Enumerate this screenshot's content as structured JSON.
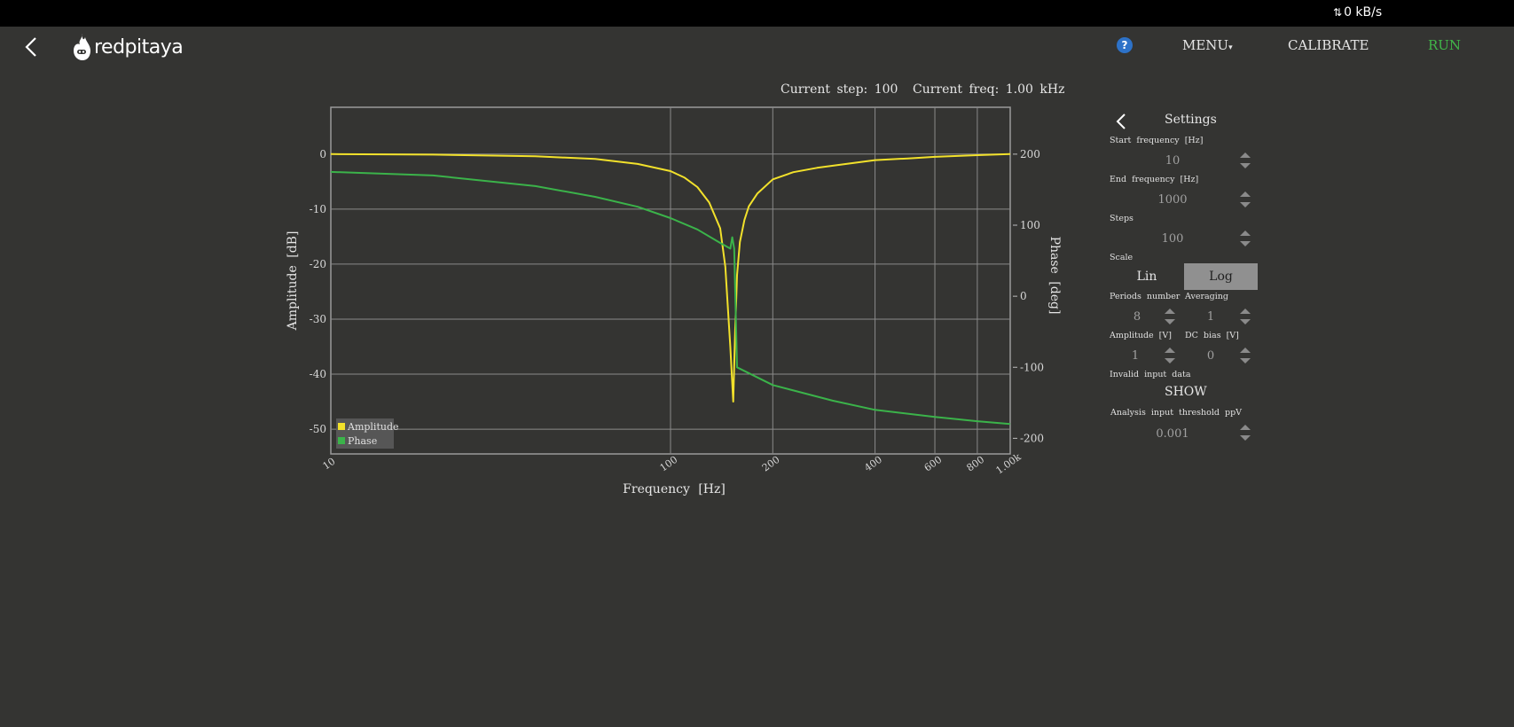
{
  "header": {
    "data_rate": "0 kB/s",
    "logo_text": "redpitaya",
    "help_label": "?",
    "menu_label": "MENU",
    "calibrate_label": "CALIBRATE",
    "run_label": "RUN"
  },
  "status": {
    "current_step": "Current step: 100",
    "current_freq": "Current freq: 1.00 kHz"
  },
  "settings": {
    "title": "Settings",
    "start_frequency_label": "Start frequency [Hz]",
    "start_frequency": "10",
    "end_frequency_label": "End frequency [Hz]",
    "end_frequency": "1000",
    "steps_label": "Steps",
    "steps": "100",
    "scale_label": "Scale",
    "scale_lin": "Lin",
    "scale_log": "Log",
    "scale_selected": "Log",
    "periods_label": "Periods number",
    "periods": "8",
    "averaging_label": "Averaging",
    "averaging": "1",
    "amplitude_label": "Amplitude [V]",
    "amplitude": "1",
    "dc_bias_label": "DC bias [V]",
    "dc_bias": "0",
    "invalid_input_label": "Invalid input data",
    "show_label": "SHOW",
    "threshold_label": "Analysis input threshold ppV",
    "threshold": "0.001"
  },
  "colors": {
    "amplitude": "#f2e12b",
    "phase": "#3bb34a",
    "run": "#41b649",
    "background": "#343432"
  },
  "chart_data": {
    "type": "line",
    "xlabel": "Frequency [Hz]",
    "ylabel": "Amplitude [dB]",
    "y2label": "Phase [deg]",
    "x_scale": "log",
    "xlim": [
      10,
      1000
    ],
    "ylim": [
      -54.5,
      8.5
    ],
    "y2lim": [
      -222,
      266
    ],
    "x_ticks": [
      "10",
      "100",
      "200",
      "400",
      "600",
      "800",
      "1.00k"
    ],
    "x_tick_values": [
      10,
      100,
      200,
      400,
      600,
      800,
      1000
    ],
    "y_ticks": [
      0,
      -10,
      -20,
      -30,
      -40,
      -50
    ],
    "y2_ticks": [
      200,
      100,
      0,
      -100,
      -200
    ],
    "grid": true,
    "legend_position": "bottom-left",
    "series": [
      {
        "name": "Amplitude",
        "axis": "left",
        "x": [
          10,
          20,
          40,
          60,
          80,
          100,
          110,
          120,
          130,
          140,
          145,
          150,
          153,
          155,
          157,
          160,
          165,
          170,
          180,
          200,
          230,
          270,
          320,
          400,
          500,
          600,
          800,
          1000
        ],
        "y": [
          0,
          -0.1,
          -0.4,
          -0.9,
          -1.8,
          -3.1,
          -4.3,
          -6.0,
          -8.8,
          -13.5,
          -20.5,
          -35.0,
          -45.0,
          -32.0,
          -22.0,
          -16.0,
          -12.0,
          -9.5,
          -7.2,
          -4.6,
          -3.3,
          -2.5,
          -1.9,
          -1.1,
          -0.8,
          -0.5,
          -0.2,
          0
        ]
      },
      {
        "name": "Phase",
        "axis": "right",
        "x": [
          10,
          20,
          40,
          60,
          80,
          100,
          120,
          140,
          150,
          152,
          154,
          157,
          200,
          300,
          400,
          600,
          800,
          1000
        ],
        "y": [
          175,
          170,
          155,
          140,
          126,
          110,
          94,
          75,
          67,
          83,
          67,
          -100,
          -125,
          -147,
          -160,
          -170,
          -176,
          -180
        ]
      }
    ]
  }
}
